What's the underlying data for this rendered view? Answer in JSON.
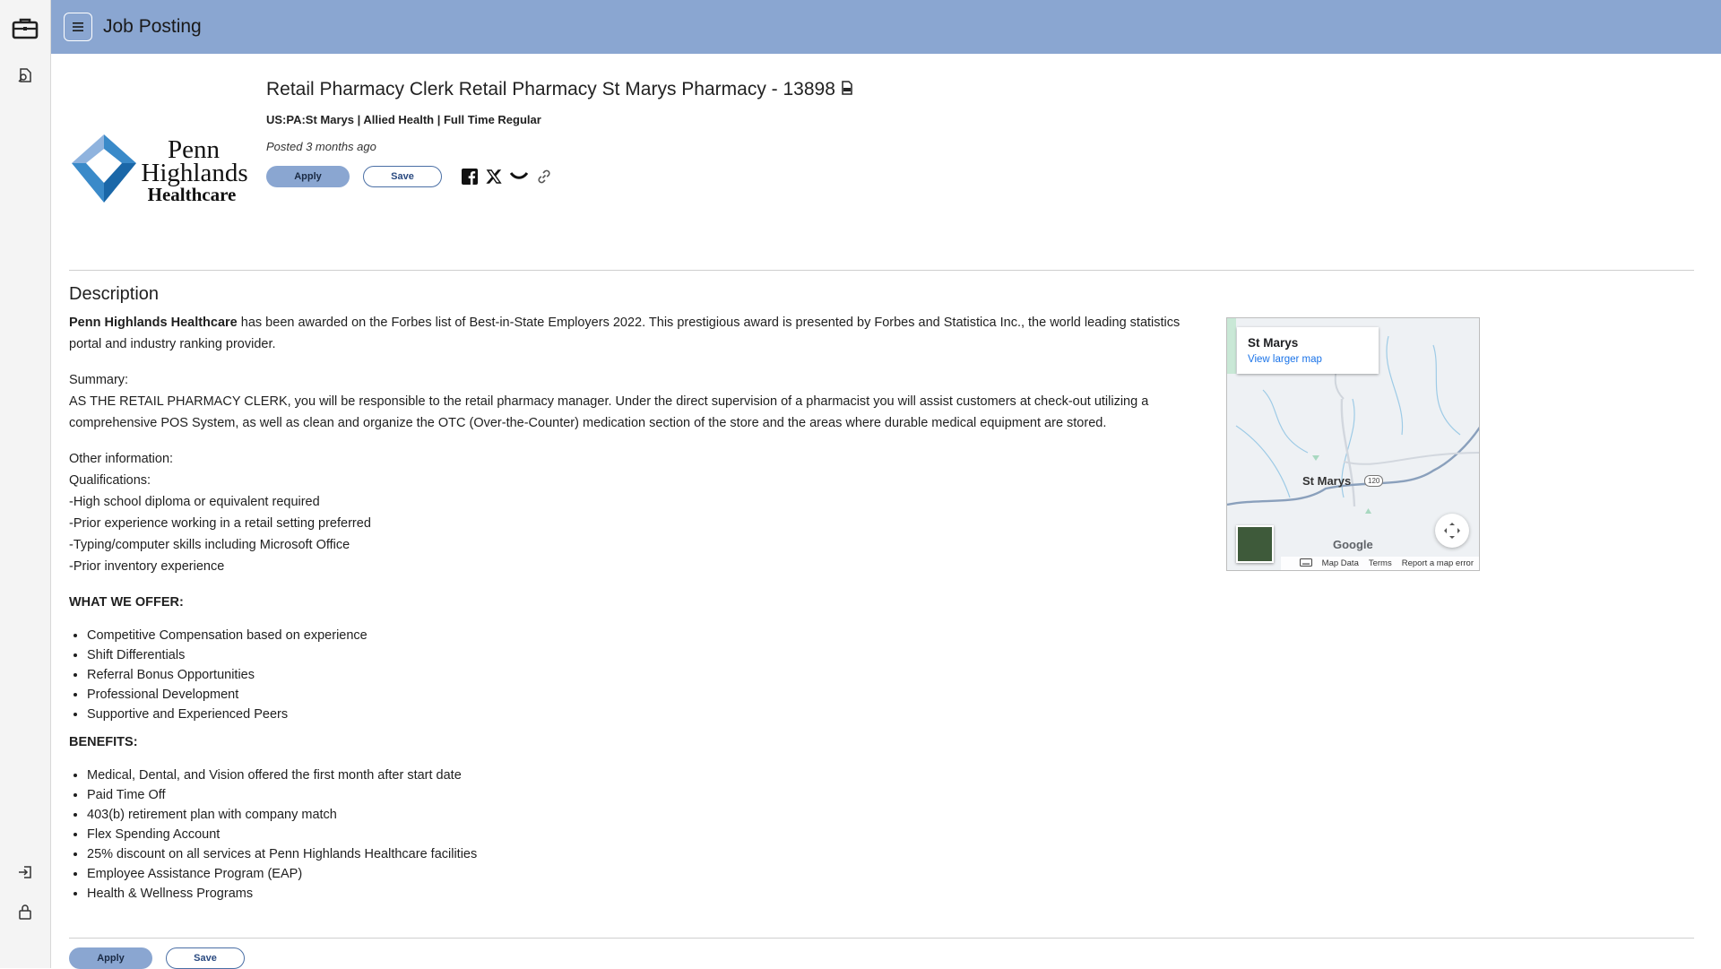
{
  "app": {
    "title": "Job Posting"
  },
  "rail": {
    "icons": [
      "briefcase-icon",
      "document-search-icon",
      "login-icon",
      "lock-icon"
    ]
  },
  "job": {
    "title": "Retail Pharmacy Clerk Retail Pharmacy St Marys Pharmacy - 13898",
    "meta": "US:PA:St Marys | Allied Health | Full Time Regular",
    "posted": "Posted 3 months ago",
    "logo": {
      "line1": "Penn",
      "line2": "Highlands",
      "line3": "Healthcare",
      "colors": {
        "dark": "#1a67a8",
        "light": "#8fb3de",
        "mid": "#3a8ac9"
      }
    }
  },
  "actions": {
    "apply_label": "Apply",
    "save_label": "Save"
  },
  "share": [
    "facebook-icon",
    "x-icon",
    "email-icon",
    "link-icon"
  ],
  "description": {
    "heading": "Description",
    "intro_bold": "Penn Highlands Healthcare",
    "intro_rest": " has been awarded on the Forbes list of Best-in-State Employers 2022. This prestigious award is presented by Forbes and Statistica Inc., the world leading statistics portal and industry ranking provider.",
    "summary_label": "Summary:",
    "summary_text": "AS THE RETAIL PHARMACY CLERK, you will be responsible to the retail pharmacy manager. Under the direct supervision of a pharmacist you will assist customers at check-out utilizing a comprehensive POS System, as well as clean and organize the OTC (Over-the-Counter) medication section of the store and the areas where durable medical equipment are stored.",
    "other_label": "Other information:",
    "qualifications_label": "Qualifications:",
    "qualifications": [
      "-High school diploma or equivalent required",
      "-Prior experience working in a retail setting preferred",
      "-Typing/computer skills including Microsoft Office",
      "-Prior inventory experience"
    ],
    "offer_heading": "WHAT WE OFFER:",
    "offers": [
      "Competitive Compensation based on experience",
      "Shift Differentials",
      "Referral Bonus Opportunities",
      "Professional Development",
      "Supportive and Experienced Peers"
    ],
    "benefits_heading": "BENEFITS:",
    "benefits": [
      "Medical, Dental, and Vision offered the first month after start date",
      "Paid Time Off",
      "403(b) retirement plan with company match",
      "Flex Spending Account",
      "25% discount on all services at Penn Highlands Healthcare facilities",
      "Employee Assistance Program (EAP)",
      "Health & Wellness Programs"
    ]
  },
  "map": {
    "place": "St Marys",
    "view_larger": "View larger map",
    "town_label": "St Marys",
    "route_shield": "120",
    "brand": "Google",
    "footer": {
      "map_data": "Map Data",
      "terms": "Terms",
      "report": "Report a map error"
    }
  }
}
